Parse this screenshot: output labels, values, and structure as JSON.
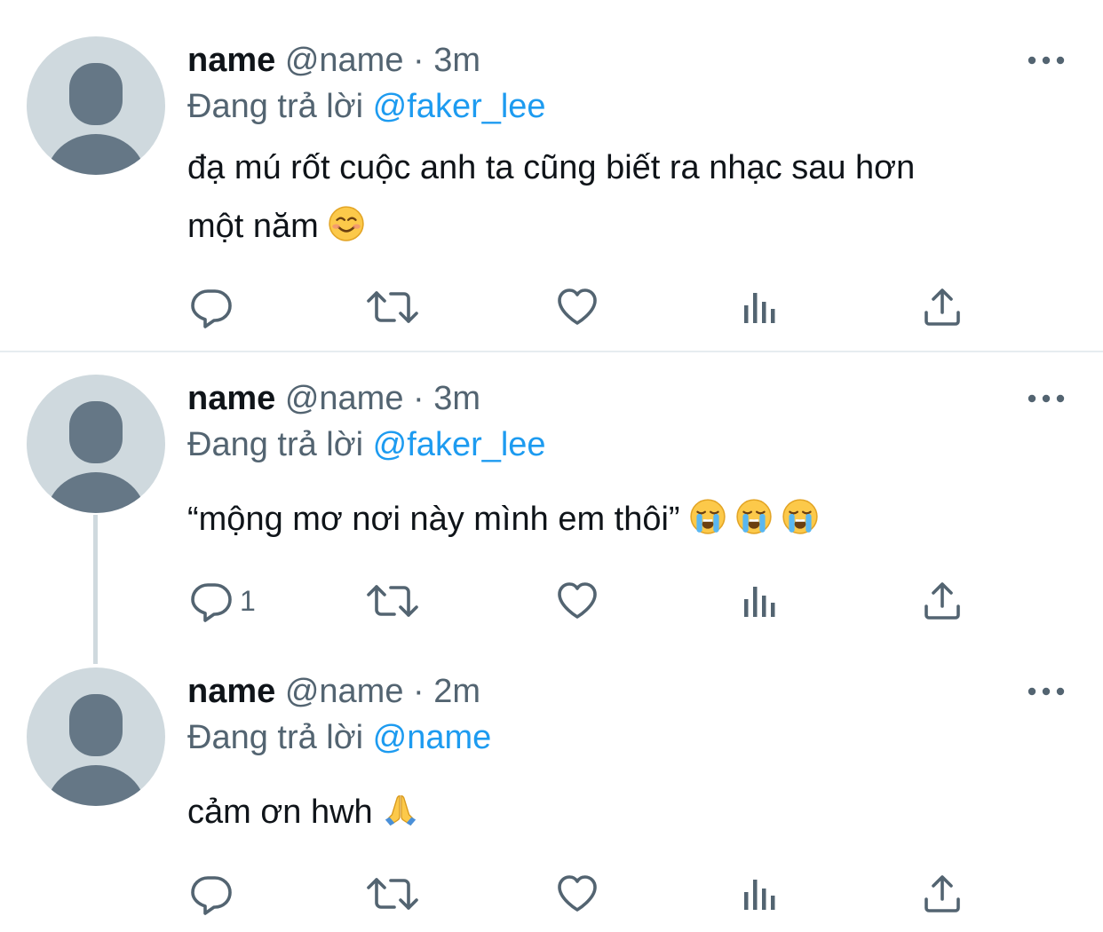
{
  "colors": {
    "accent": "#1d9bf0",
    "text_primary": "#0f1419",
    "text_secondary": "#536471",
    "avatar_bg": "#cfd9de",
    "avatar_fg": "#657786"
  },
  "tweets": [
    {
      "display_name": "name",
      "handle": "@name",
      "separator": "·",
      "time": "3m",
      "replying_prefix": "Đang trả lời",
      "replying_to": "@faker_lee",
      "text_line1": "đạ mú rốt cuộc anh ta cũng biết ra nhạc sau hơn",
      "text_line2": "một năm",
      "emojis": [
        "smiling-face-emoji"
      ],
      "reply_count": "",
      "retweet_count": "",
      "like_count": ""
    },
    {
      "display_name": "name",
      "handle": "@name",
      "separator": "·",
      "time": "3m",
      "replying_prefix": "Đang trả lời",
      "replying_to": "@faker_lee",
      "text": "“mộng mơ nơi này mình em thôi”",
      "emojis": [
        "crying-face-emoji",
        "crying-face-emoji",
        "crying-face-emoji"
      ],
      "reply_count": "1",
      "retweet_count": "",
      "like_count": ""
    },
    {
      "display_name": "name",
      "handle": "@name",
      "separator": "·",
      "time": "2m",
      "replying_prefix": "Đang trả lời",
      "replying_to": "@name",
      "text": "cảm ơn hwh",
      "emojis": [
        "folded-hands-emoji"
      ],
      "reply_count": "",
      "retweet_count": "",
      "like_count": ""
    }
  ],
  "icons": {
    "reply": "reply-icon",
    "retweet": "retweet-icon",
    "like": "heart-icon",
    "views": "analytics-icon",
    "share": "share-icon",
    "more": "more-icon"
  }
}
